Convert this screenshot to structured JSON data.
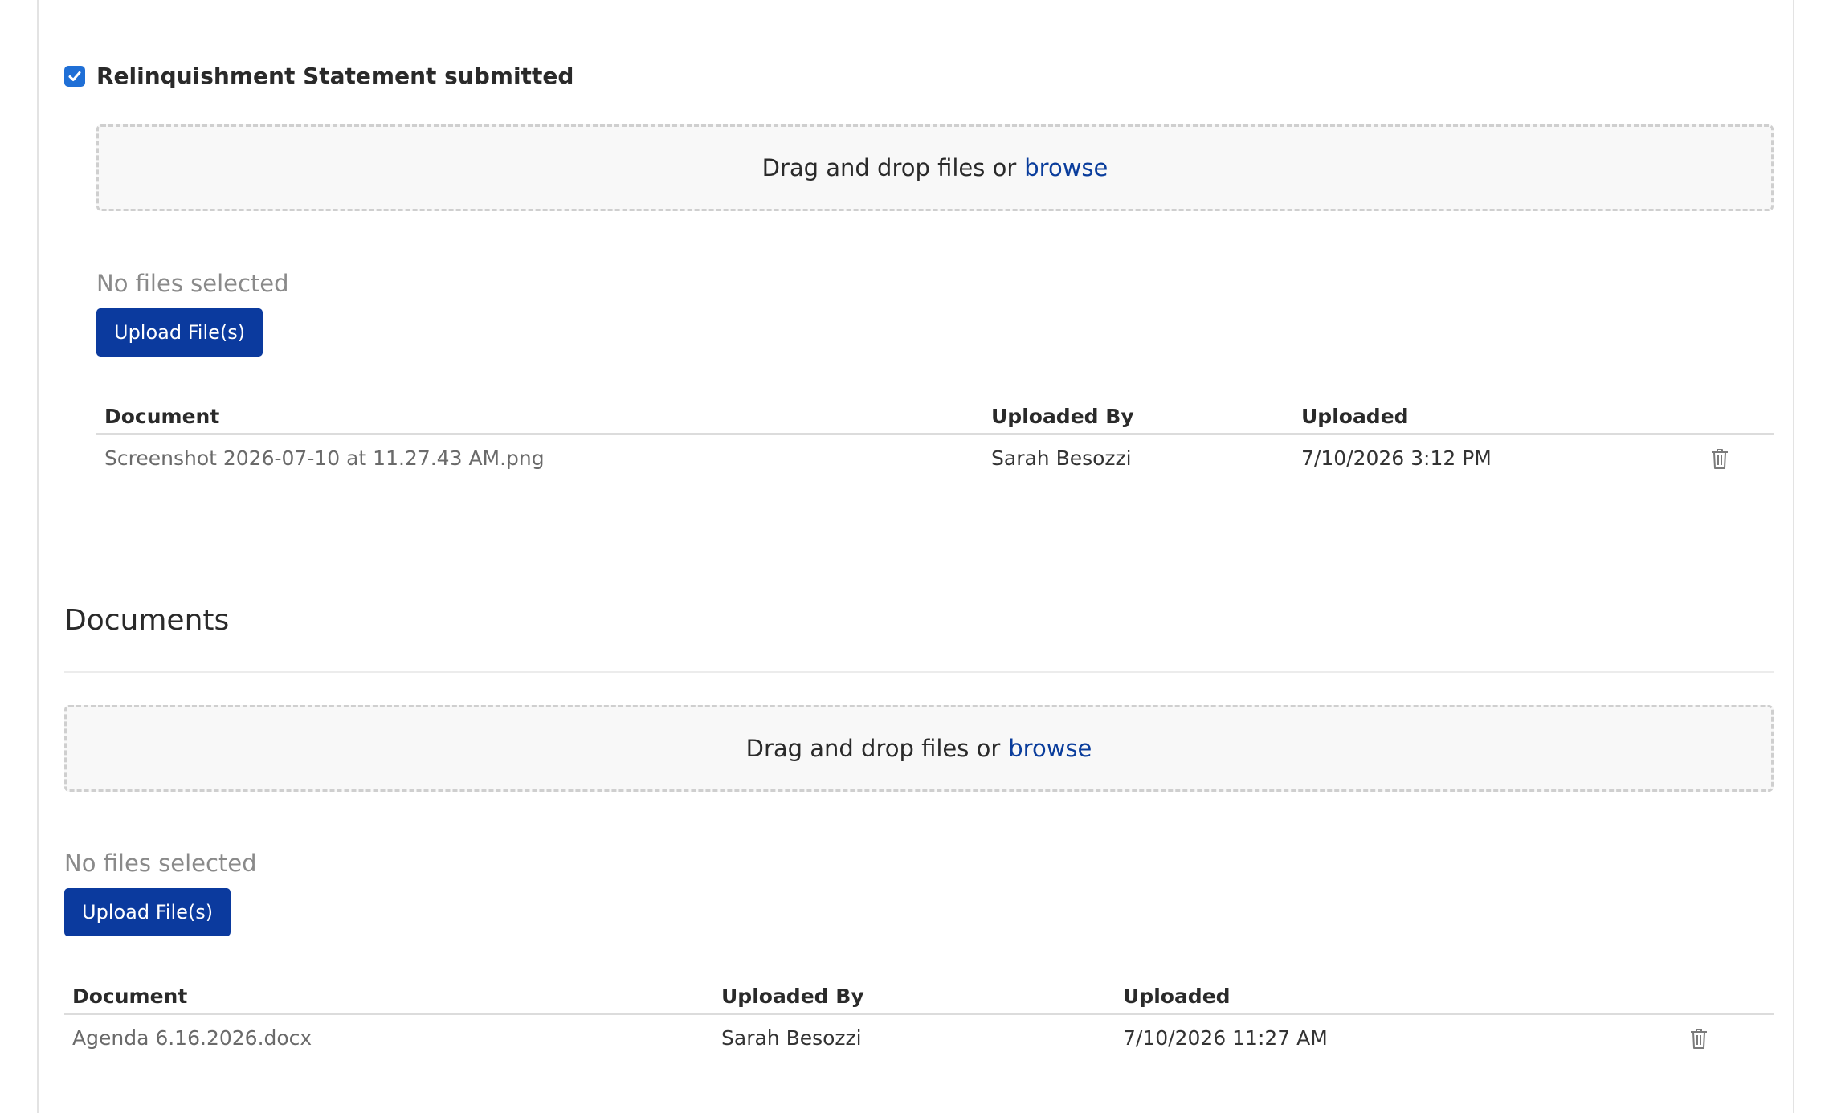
{
  "relinquishment": {
    "checkbox_label": "Relinquishment Statement submitted",
    "checked": true,
    "dropzone": {
      "text": "Drag and drop files or",
      "browse_label": "browse"
    },
    "no_files_text": "No files selected",
    "upload_label": "Upload File(s)",
    "table": {
      "headers": {
        "document": "Document",
        "uploaded_by": "Uploaded By",
        "uploaded": "Uploaded"
      },
      "rows": [
        {
          "document": "Screenshot 2026-07-10 at 11.27.43 AM.png",
          "uploaded_by": "Sarah Besozzi",
          "uploaded": "7/10/2026 3:12 PM"
        }
      ]
    }
  },
  "documents": {
    "title": "Documents",
    "dropzone": {
      "text": "Drag and drop files or",
      "browse_label": "browse"
    },
    "no_files_text": "No files selected",
    "upload_label": "Upload File(s)",
    "table": {
      "headers": {
        "document": "Document",
        "uploaded_by": "Uploaded By",
        "uploaded": "Uploaded"
      },
      "rows": [
        {
          "document": "Agenda 6.16.2026.docx",
          "uploaded_by": "Sarah Besozzi",
          "uploaded": "7/10/2026 11:27 AM"
        }
      ]
    }
  },
  "icons": {
    "checkbox": "check-icon",
    "delete": "trash-icon"
  },
  "colors": {
    "accent": "#0b3a9e",
    "link": "#0a3d9c",
    "checkbox": "#1f6fd6"
  }
}
